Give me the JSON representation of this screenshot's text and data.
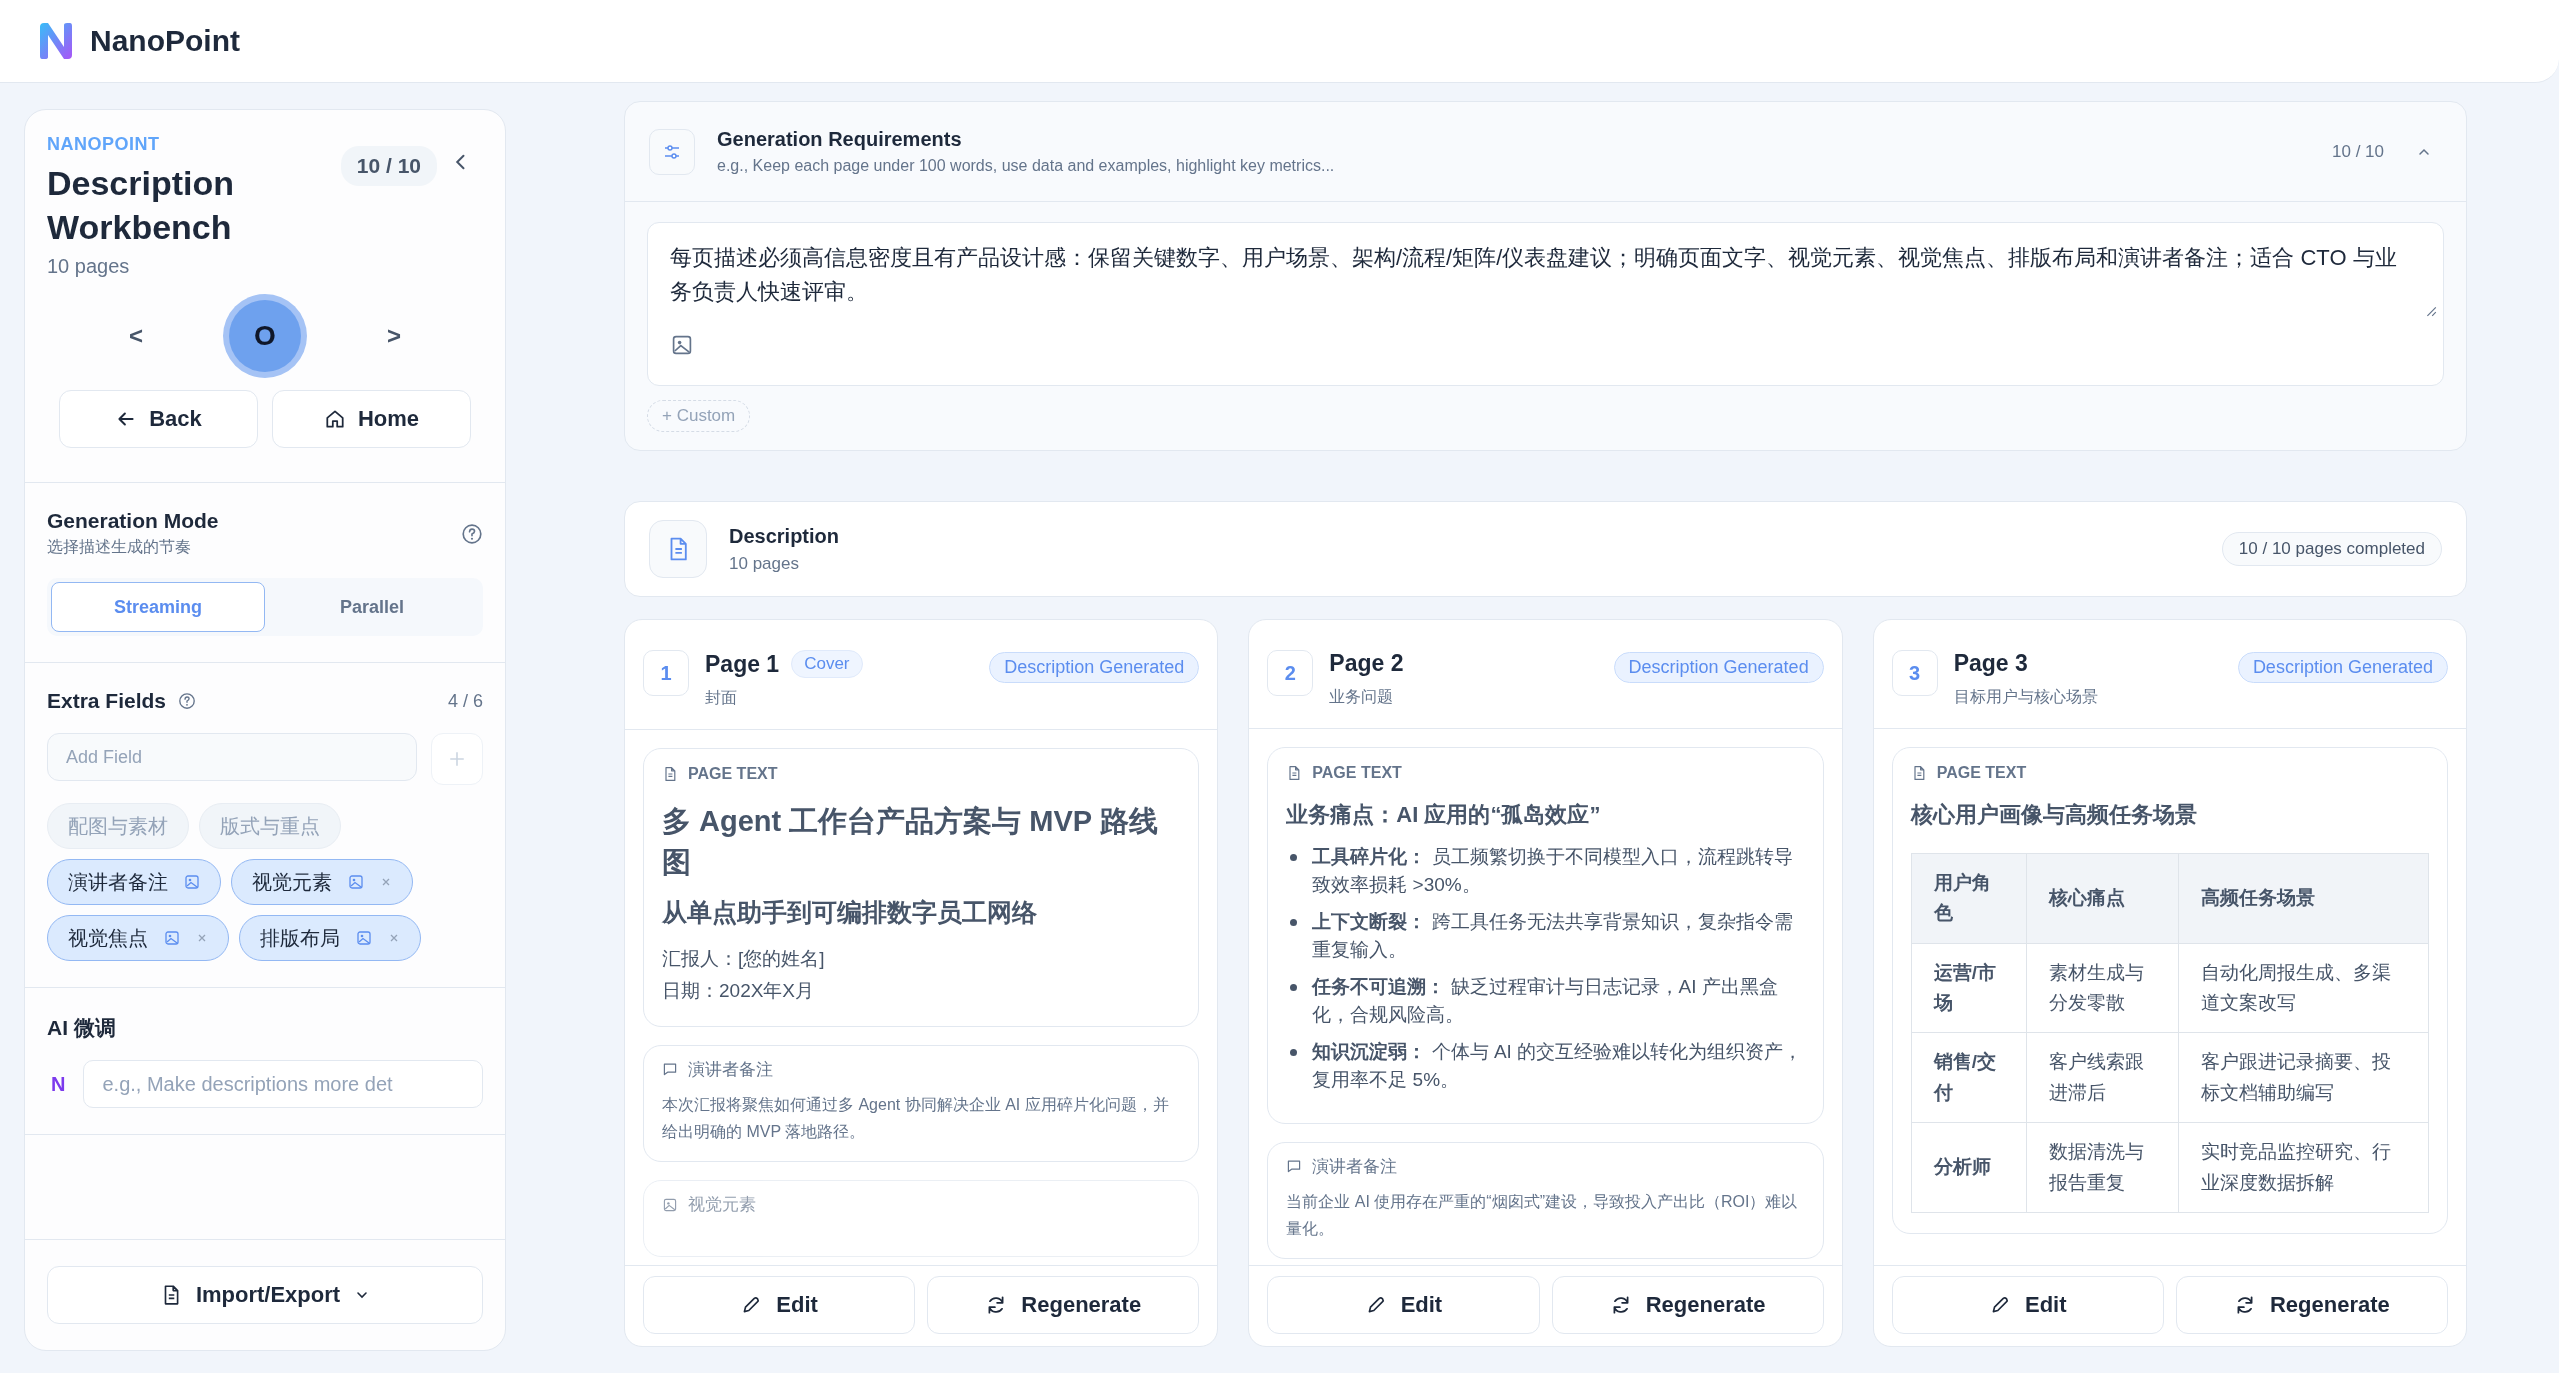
{
  "app": {
    "name": "NanoPoint"
  },
  "sidebar": {
    "eyebrow": "NANOPOINT",
    "title": "Description Workbench",
    "subtitle": "10 pages",
    "counter": "10 / 10",
    "prev": "<",
    "next": ">",
    "avatar": "O",
    "buttons": [
      {
        "kind": "back",
        "label": "Back"
      },
      {
        "kind": "home",
        "label": "Home"
      }
    ]
  },
  "generation_mode": {
    "title": "Generation Mode",
    "subtitle": "选择描述生成的节奏",
    "options": [
      {
        "label": "Streaming",
        "selected": true
      },
      {
        "label": "Parallel",
        "selected": false
      }
    ]
  },
  "extra_fields": {
    "title": "Extra Fields",
    "count": "4 / 6",
    "placeholder": "Add Field",
    "fields": [
      {
        "label": "配图与素材",
        "enabled": false,
        "removable": false
      },
      {
        "label": "版式与重点",
        "enabled": false,
        "removable": false
      },
      {
        "label": "演讲者备注",
        "enabled": true,
        "removable": false
      },
      {
        "label": "视觉元素",
        "enabled": true,
        "removable": true
      },
      {
        "label": "视觉焦点",
        "enabled": true,
        "removable": true
      },
      {
        "label": "排版布局",
        "enabled": true,
        "removable": true
      }
    ]
  },
  "ai_tune": {
    "title": "AI 微调",
    "badge": "N",
    "placeholder": "e.g., Make descriptions more det"
  },
  "import_export": {
    "label": "Import/Export"
  },
  "requirements": {
    "title": "Generation Requirements",
    "hint": "e.g., Keep each page under 100 words, use data and examples, highlight key metrics...",
    "counter": "10 / 10",
    "expanded": true,
    "text": "每页描述必须高信息密度且有产品设计感：保留关键数字、用户场景、架构/流程/矩阵/仪表盘建议；明确页面文字、视觉元素、视觉焦点、排版布局和演讲者备注；适合 CTO 与业务负责人快速评审。",
    "custom": "+ Custom"
  },
  "description": {
    "title": "Description",
    "subtitle": "10 pages",
    "status": "10 / 10 pages completed"
  },
  "pages": [
    {
      "number": "1",
      "title": "Page 1",
      "tag": "Cover",
      "subtitle": "封面",
      "status": "Description Generated",
      "sections": [
        {
          "kind": "page_text",
          "label": "PAGE TEXT",
          "heading": "多 Agent 工作台产品方案与 MVP 路线图",
          "subheading": "从单点助手到可编排数字员工网络",
          "lines": [
            "汇报人：[您的姓名]",
            "日期：202X年X月"
          ]
        },
        {
          "kind": "notes",
          "label": "演讲者备注",
          "text": "本次汇报将聚焦如何通过多 Agent 协同解决企业 AI 应用碎片化问题，并给出明确的 MVP 落地路径。"
        },
        {
          "kind": "visual",
          "label": "视觉元素"
        }
      ],
      "actions": [
        "Edit",
        "Regenerate"
      ]
    },
    {
      "number": "2",
      "title": "Page 2",
      "subtitle": "业务问题",
      "status": "Description Generated",
      "sections": [
        {
          "kind": "page_text",
          "label": "PAGE TEXT",
          "heading": "业务痛点：AI 应用的“孤岛效应”",
          "bullets": [
            "**工具碎片化：** 员工频繁切换于不同模型入口，流程跳转导致效率损耗 >30%。",
            "**上下文断裂：** 跨工具任务无法共享背景知识，复杂指令需重复输入。",
            "**任务不可追溯：** 缺乏过程审计与日志记录，AI 产出黑盒化，合规风险高。",
            "**知识沉淀弱：** 个体与 AI 的交互经验难以转化为组织资产，复用率不足 5%。"
          ]
        },
        {
          "kind": "notes",
          "label": "演讲者备注",
          "text": "当前企业 AI 使用存在严重的“烟囱式”建设，导致投入产出比（ROI）难以量化。"
        }
      ],
      "actions": [
        "Edit",
        "Regenerate"
      ]
    },
    {
      "number": "3",
      "title": "Page 3",
      "subtitle": "目标用户与核心场景",
      "status": "Description Generated",
      "sections": [
        {
          "kind": "page_text",
          "label": "PAGE TEXT",
          "heading": "核心用户画像与高频任务场景",
          "table": {
            "columns": [
              "用户角色",
              "核心痛点",
              "高频任务场景"
            ],
            "rows": [
              [
                "运营/市场",
                "素材生成与分发零散",
                "自动化周报生成、多渠道文案改写"
              ],
              [
                "销售/交付",
                "客户线索跟进滞后",
                "客户跟进记录摘要、投标文档辅助编写"
              ],
              [
                "分析师",
                "数据清洗与报告重复",
                "实时竞品监控研究、行业深度数据拆解"
              ]
            ]
          }
        }
      ],
      "actions": [
        "Edit",
        "Regenerate"
      ]
    }
  ]
}
